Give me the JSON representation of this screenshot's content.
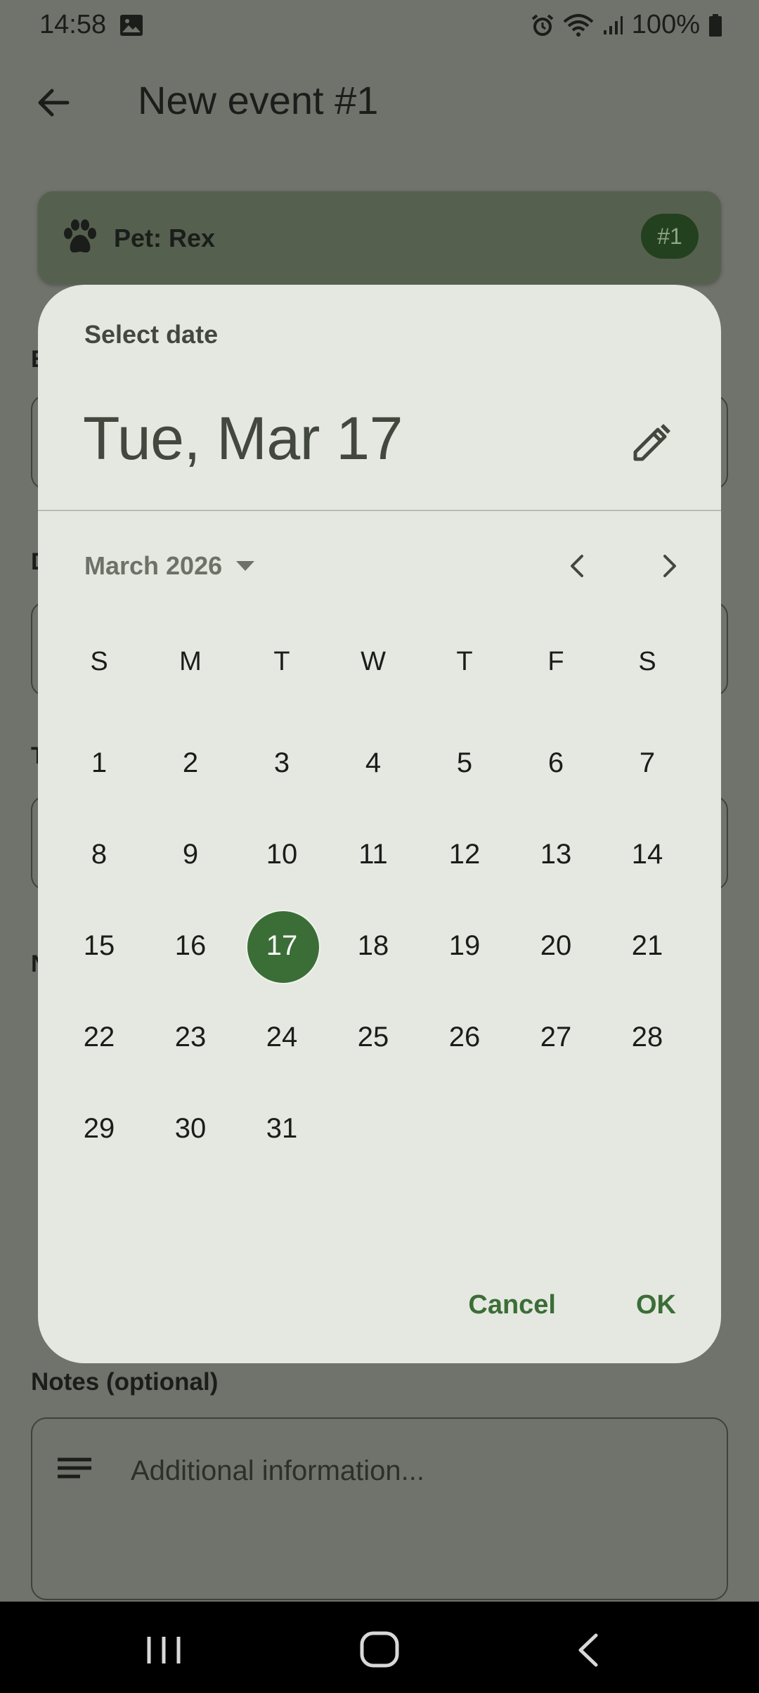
{
  "status_bar": {
    "time": "14:58",
    "battery": "100%",
    "icons": [
      "gallery-icon",
      "alarm-icon",
      "wifi-icon",
      "signal-icon",
      "battery-icon"
    ]
  },
  "app_bar": {
    "title": "New event #1"
  },
  "pet_card": {
    "label": "Pet: Rex",
    "badge": "#1",
    "icon": "paw-icon"
  },
  "notes": {
    "label": "Notes (optional)",
    "placeholder": "Additional information..."
  },
  "date_picker": {
    "headline": "Select date",
    "selected_date": "Tue, Mar 17",
    "month_label": "March 2026",
    "weekdays": [
      "S",
      "M",
      "T",
      "W",
      "T",
      "F",
      "S"
    ],
    "days": [
      "1",
      "2",
      "3",
      "4",
      "5",
      "6",
      "7",
      "8",
      "9",
      "10",
      "11",
      "12",
      "13",
      "14",
      "15",
      "16",
      "17",
      "18",
      "19",
      "20",
      "21",
      "22",
      "23",
      "24",
      "25",
      "26",
      "27",
      "28",
      "29",
      "30",
      "31"
    ],
    "first_weekday_index": 0,
    "selected_day": "17",
    "cancel_label": "Cancel",
    "ok_label": "OK",
    "accent_color": "#3b6e37"
  },
  "colors": {
    "scrim": "#6f736b",
    "dialog_surface": "#e5e8e0",
    "badge_bg": "#23401f"
  }
}
